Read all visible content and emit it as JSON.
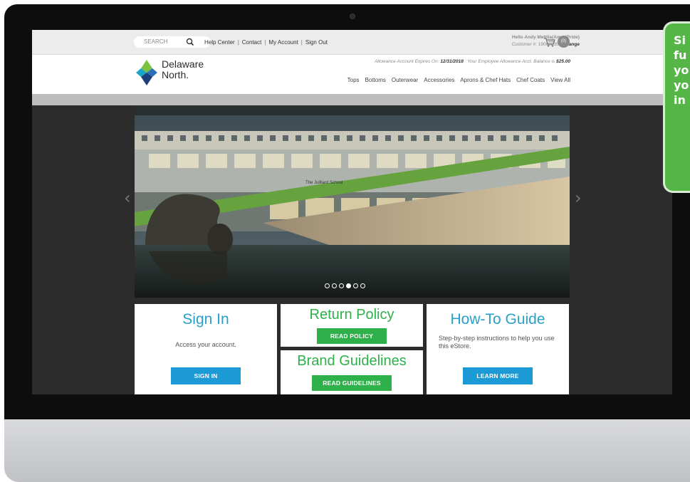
{
  "topbar": {
    "search_placeholder": "SEARCH",
    "links": [
      "Help Center",
      "Contact",
      "My Account",
      "Sign Out"
    ],
    "greeting": "Hello Andy Mettila(AmeriPride)",
    "customer_label": "Customer #:",
    "customer_number": "190002351",
    "change_label": "Change",
    "cart_count": "(0)"
  },
  "header": {
    "logo_line1": "Delaware",
    "logo_line2": "North.",
    "allowance_expires_label": "Allowance Account Expires On:",
    "allowance_expires_date": "12/31/2018",
    "allowance_balance_label": "Your Employee Allowance Acct. Balance is",
    "allowance_balance": "$25.00",
    "nav": [
      "Tops",
      "Bottoms",
      "Outerwear",
      "Accessories",
      "Aprons & Chef Hats",
      "Chef Coats",
      "View All"
    ]
  },
  "carousel": {
    "slide_count": 6,
    "active_index": 3,
    "prev_glyph": "‹",
    "next_glyph": "›",
    "building_sign": "The Juilliard School"
  },
  "cards": {
    "sign_in": {
      "title": "Sign In",
      "desc": "Access your account.",
      "button": "SIGN IN"
    },
    "return_policy": {
      "title": "Return Policy",
      "button": "READ POLICY"
    },
    "brand_guidelines": {
      "title": "Brand Guidelines",
      "button": "READ GUIDELINES"
    },
    "how_to": {
      "title": "How-To Guide",
      "desc": "Step-by-step instructions to help you use this eStore.",
      "button": "LEARN MORE"
    }
  },
  "callout": {
    "text": "Si\nfu\nyo\nyo\nin"
  },
  "colors": {
    "accent_blue": "#1b9ad6",
    "accent_green": "#2eb04b",
    "title_blue": "#28a0c8",
    "callout_green": "#55b547"
  }
}
